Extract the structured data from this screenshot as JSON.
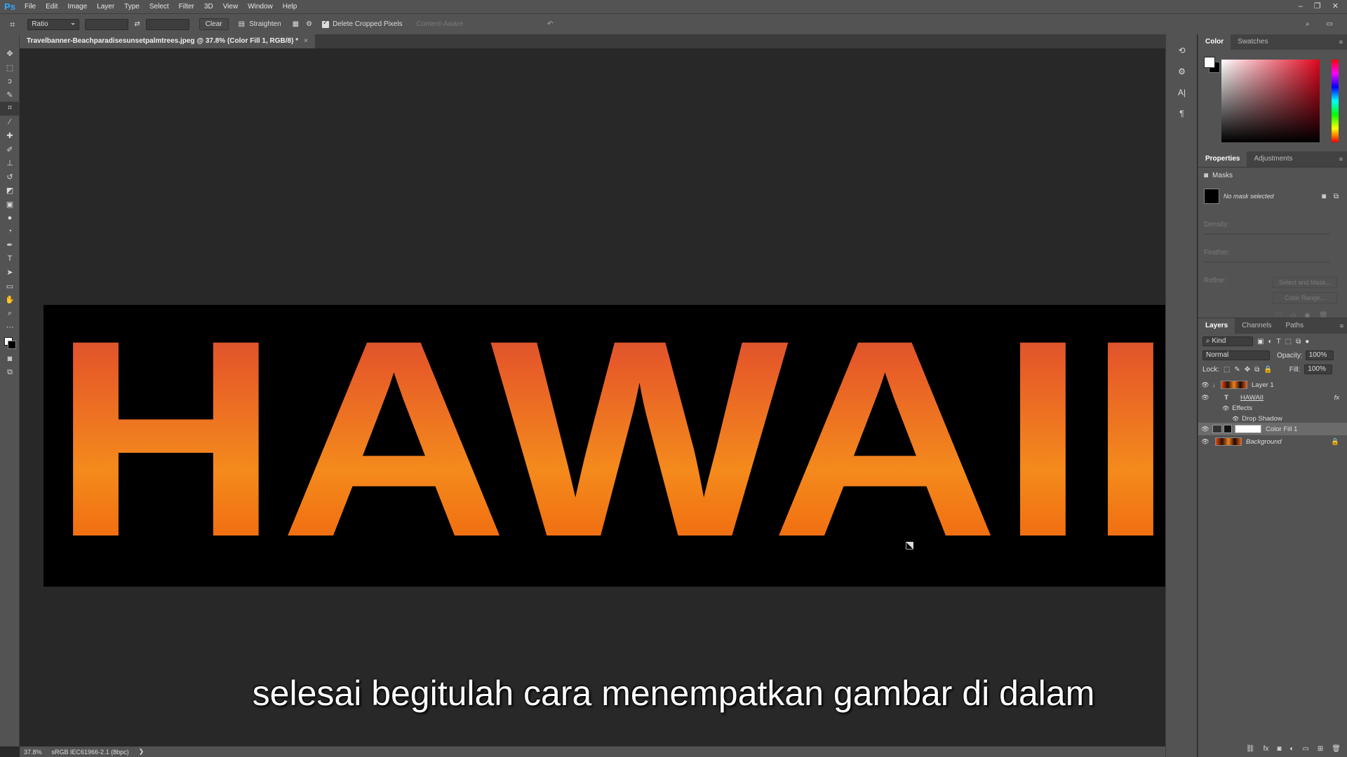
{
  "app": {
    "logo": "Ps"
  },
  "menu": [
    "File",
    "Edit",
    "Image",
    "Layer",
    "Type",
    "Select",
    "Filter",
    "3D",
    "View",
    "Window",
    "Help"
  ],
  "window_controls": {
    "minimize": "–",
    "restore": "❐",
    "close": "✕"
  },
  "options": {
    "ratio_select": "Ratio",
    "clear_label": "Clear",
    "straighten_label": "Straighten",
    "delete_cropped_label": "Delete Cropped Pixels",
    "content_aware_label": "Content-Aware",
    "swap_glyph": "⇄",
    "reset_glyph": "↶"
  },
  "document": {
    "tab_title": "Travelbanner-Beachparadisesunsetpalmtrees.jpeg @ 37.8% (Color Fill 1, RGB/8) *",
    "close_glyph": "×",
    "artwork_text": "HAWAII"
  },
  "subtitle": "selesai begitulah cara menempatkan gambar di dalam",
  "status": {
    "zoom": "37.8%",
    "profile": "sRGB IEC61966-2.1 (8bpc)"
  },
  "panels": {
    "color_tabs": [
      "Color",
      "Swatches"
    ],
    "properties_tabs": [
      "Properties",
      "Adjustments"
    ],
    "masks_label": "Masks",
    "no_mask": "No mask selected",
    "density_label": "Density:",
    "feather_label": "Feather:",
    "refine_label": "Refine:",
    "select_mask_btn": "Select and Mask...",
    "color_range_btn": "Color Range...",
    "layers_tabs": [
      "Layers",
      "Channels",
      "Paths"
    ],
    "kind_filter": "Kind",
    "blend_mode": "Normal",
    "opacity_label": "Opacity:",
    "opacity_value": "100%",
    "lock_label": "Lock:",
    "fill_label": "Fill:",
    "fill_value": "100%",
    "layers": [
      {
        "name": "Layer 1"
      },
      {
        "name": "HAWAII",
        "fx": "fx"
      },
      {
        "name": "Effects"
      },
      {
        "name": "Drop Shadow"
      },
      {
        "name": "Color Fill 1"
      },
      {
        "name": "Background"
      }
    ]
  },
  "colors": {
    "accent": "#31a8ff",
    "ui_bg": "#535353",
    "canvas_bg": "#282828",
    "selected_layer": "#6b6b6b"
  }
}
